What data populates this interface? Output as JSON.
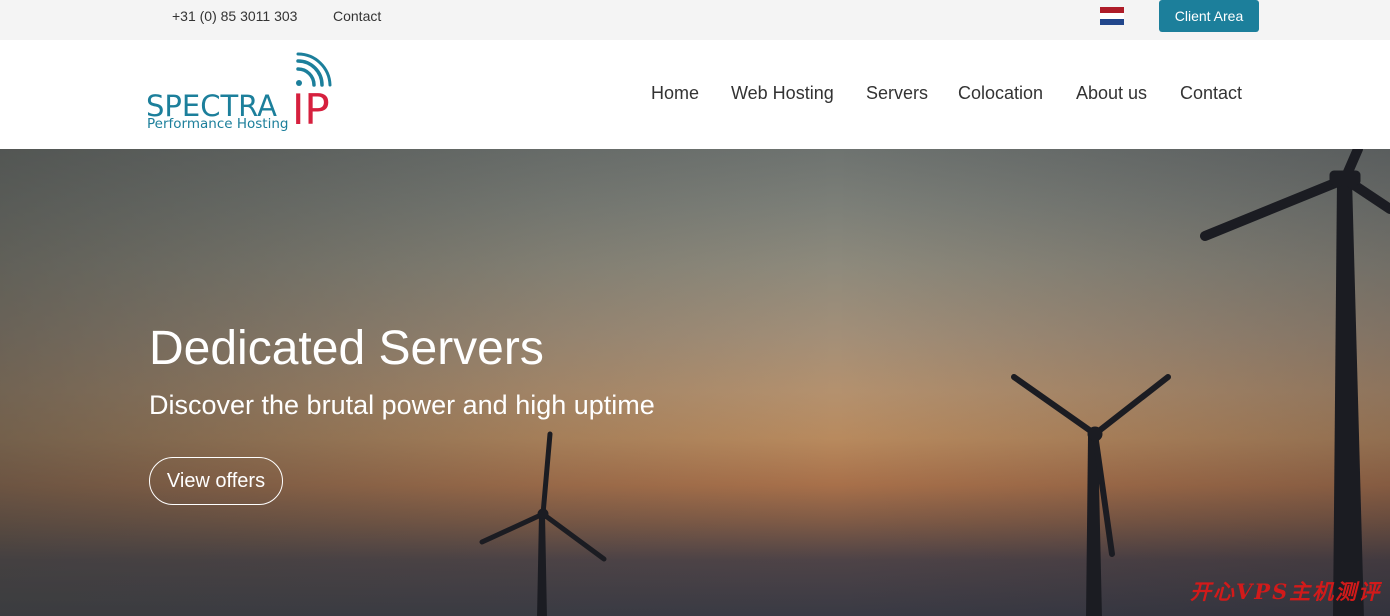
{
  "topbar": {
    "phone": "+31 (0) 85 3011 303",
    "contact": "Contact",
    "flag_icon": "netherlands-flag-icon",
    "client_area": "Client Area"
  },
  "logo": {
    "brand": "SPECTRA",
    "suffix": "IP",
    "tagline": "Performance Hosting",
    "colors": {
      "teal": "#1c7f9b",
      "red": "#d6203e"
    }
  },
  "nav": {
    "items": [
      {
        "label": "Home"
      },
      {
        "label": "Web Hosting"
      },
      {
        "label": "Servers"
      },
      {
        "label": "Colocation"
      },
      {
        "label": "About us"
      },
      {
        "label": "Contact"
      }
    ]
  },
  "hero": {
    "title": "Dedicated Servers",
    "subtitle": "Discover the brutal power and high uptime",
    "cta": "View offers"
  },
  "watermark": "开心VPS主机测评"
}
